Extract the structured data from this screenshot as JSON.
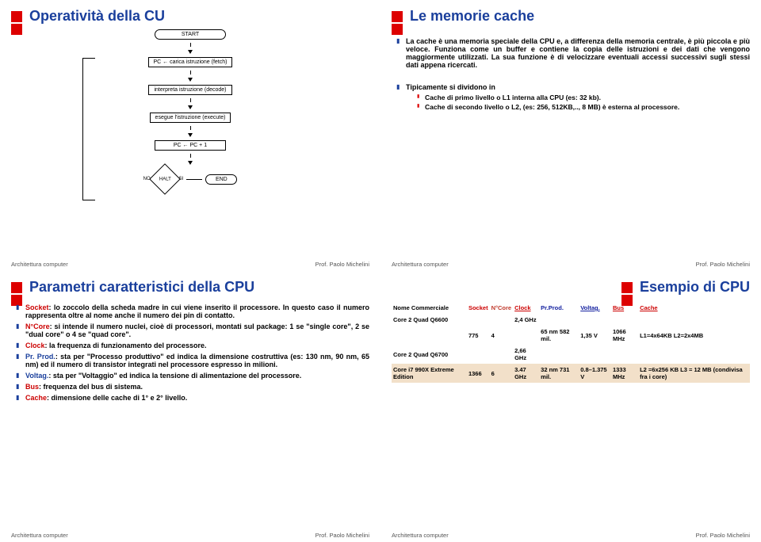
{
  "footer": {
    "left": "Architettura computer",
    "right": "Prof. Paolo Michelini"
  },
  "slide1": {
    "title": "Operatività della CU",
    "flow": {
      "start": "START",
      "fetch": "PC ← carica istruzione (fetch)",
      "decode": "interpreta istruzione (decode)",
      "execute": "esegue l'istruzione (execute)",
      "inc": "PC ← PC + 1",
      "halt": "HALT",
      "no": "NO",
      "si": "SI",
      "end": "END"
    }
  },
  "slide2": {
    "title": "Le memorie cache",
    "p1": "La cache è una memoria speciale della CPU e, a differenza della memoria centrale, è più piccola e più veloce. Funziona come un buffer e contiene la copia delle istruzioni e dei dati che vengono maggiormente utilizzati. La sua funzione è di velocizzare eventuali accessi successivi sugli stessi dati appena ricercati.",
    "p2": "Tipicamente si dividono in",
    "n1": "Cache di primo livello o L1 interna alla CPU (es: 32 kb).",
    "n2": "Cache di secondo livello o L2, (es: 256, 512KB,.., 8 MB) è esterna al processore."
  },
  "slide3": {
    "title": "Parametri caratteristici della CPU",
    "items": [
      {
        "label": "Socket",
        "text": ": lo zoccolo della scheda madre in cui viene inserito il processore. In questo caso il numero rappresenta oltre al nome anche il numero dei pin di contatto."
      },
      {
        "label": "N°Core",
        "text": ": si intende il numero nuclei, cioè di processori, montati sul package: 1 se \"single core\", 2 se \"dual core\" o 4 se \"quad core\"."
      },
      {
        "label": "Clock",
        "text": ": la frequenza di funzionamento del processore."
      },
      {
        "label": "Pr. Prod.",
        "text": ": sta per \"Processo produttivo\" ed indica la dimensione costruttiva (es: 130 nm, 90 nm, 65 nm) ed il numero di transistor integrati nel processore espresso in milioni."
      },
      {
        "label": "Voltag.",
        "text": ": sta per \"Voltaggio\" ed indica la tensione di alimentazione del processore."
      },
      {
        "label": "Bus",
        "text": ": frequenza del bus di sistema."
      },
      {
        "label": "Cache",
        "text": ": dimensione delle cache di 1° e 2° livello."
      }
    ]
  },
  "slide4": {
    "title": "Esempio di CPU",
    "headers": {
      "name": "Nome Commerciale",
      "socket": "Socket",
      "ncore": "N°Core",
      "clock": "Clock",
      "prprod": "Pr.Prod.",
      "volt": "Voltag.",
      "bus": "Bus",
      "cache": "Cache"
    },
    "rows": [
      {
        "name": "Core 2 Quad Q6600",
        "socket": "",
        "ncore": "",
        "clock": "2,4 GHz",
        "prprod": "",
        "volt": "",
        "bus": "",
        "cache": ""
      },
      {
        "name": "",
        "socket": "775",
        "ncore": "4",
        "clock": "",
        "prprod": "65 nm 582 mil.",
        "volt": "1,35 V",
        "bus": "1066 MHz",
        "cache": "L1=4x64KB L2=2x4MB"
      },
      {
        "name": "Core 2 Quad Q6700",
        "socket": "",
        "ncore": "",
        "clock": "2,66 GHz",
        "prprod": "",
        "volt": "",
        "bus": "",
        "cache": ""
      },
      {
        "name": "Core i7 990X Extreme Edition",
        "socket": "1366",
        "ncore": "6",
        "clock": "3.47 GHz",
        "prprod": "32 nm 731 mil.",
        "volt": "0.8–1.375 V",
        "bus": "1333 MHz",
        "cache": "L2 =6x256 KB L3 = 12 MB (condivisa fra i core)"
      }
    ]
  }
}
